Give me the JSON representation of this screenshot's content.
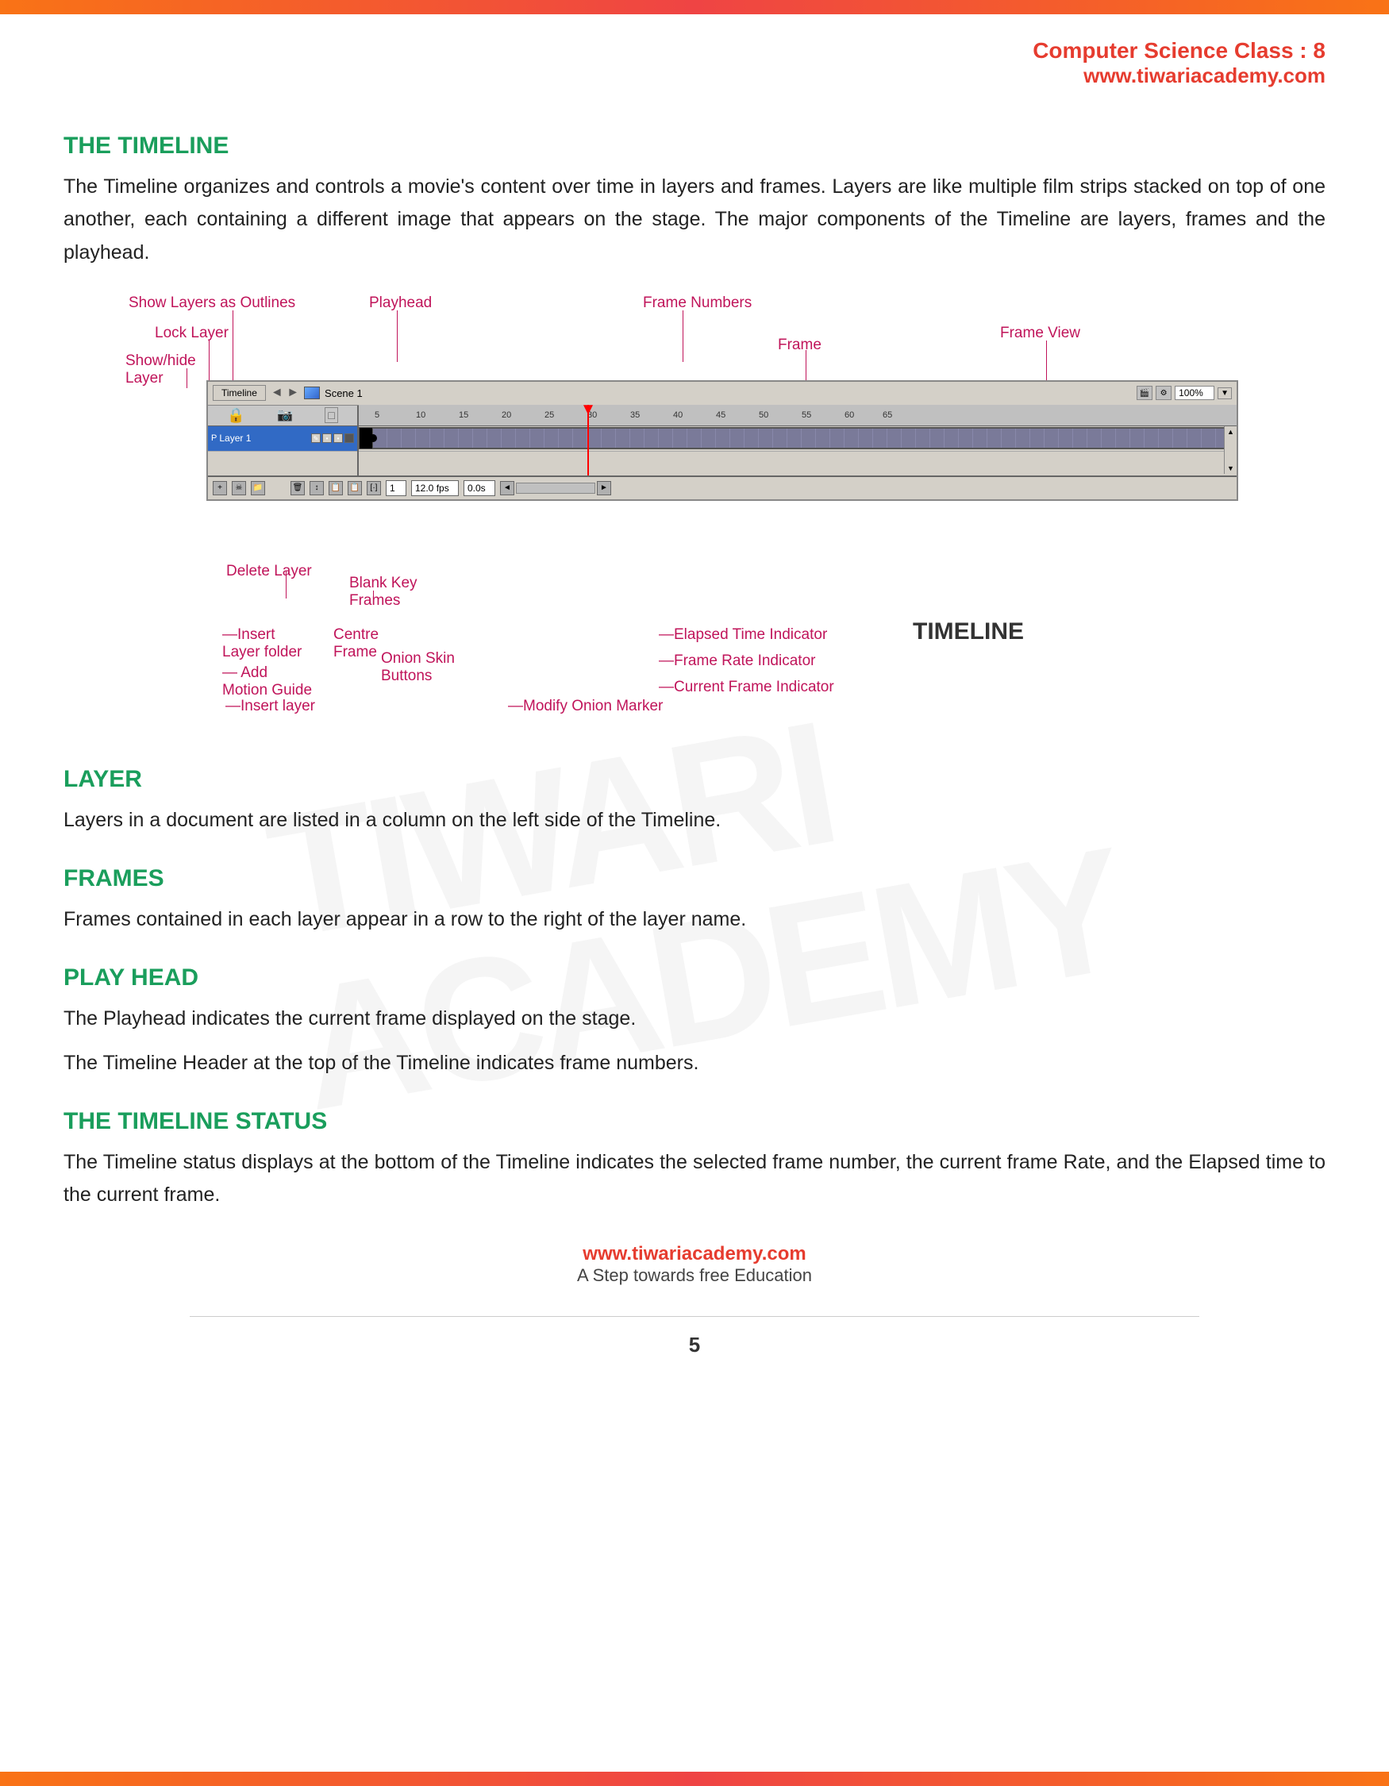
{
  "header": {
    "title": "Computer Science Class : 8",
    "url": "www.tiwariacademy.com"
  },
  "sections": {
    "timeline_heading": "THE TIMELINE",
    "timeline_body1": "The  Timeline  organizes  and  controls  a  movie's  content  over  time  in  layers  and  frames. Layers are like multiple film strips stacked on top of one another, each containing a different image that appears on the stage. The major components of the Timeline are layers, frames and the playhead.",
    "layer_heading": "LAYER",
    "layer_body": "Layers in a document are listed in a column on the left side of the Timeline.",
    "frames_heading": "FRAMES",
    "frames_body": "Frames contained in each layer appear in a row to the right of the layer name.",
    "playhead_heading": "PLAY HEAD",
    "playhead_body1": "The Playhead indicates the current frame displayed on the stage.",
    "playhead_body2": "The Timeline Header at the top of the Timeline indicates frame numbers.",
    "status_heading": "THE TIMELINE STATUS",
    "status_body": "The  Timeline  status  displays  at  the  bottom  of  the  Timeline  indicates  the  selected  frame number, the current frame Rate, and the Elapsed time to the current frame.",
    "footer_url": "www.tiwariacademy.com",
    "footer_tagline": "A Step towards free Education",
    "page_number": "5"
  },
  "diagram": {
    "labels": {
      "show_layers": "Show Layers as Outlines",
      "lock_layer": "Lock Layer",
      "show_hide": "Show/hide\nLayer",
      "playhead": "Playhead",
      "frame_numbers": "Frame Numbers",
      "frame_view": "Frame View",
      "frame": "Frame",
      "delete_layer": "Delete Layer",
      "blank_key_frames": "Blank Key\nFrames",
      "insert_layer_folder": "Insert\nLayer folder",
      "add_motion_guide": "— Add\nMotion Guide",
      "insert_layer": "—Insert layer",
      "centre_frame": "Centre\nFrame",
      "onion_skin": "Onion Skin\nButtons",
      "modify_onion": "—Modify Onion Marker",
      "current_frame": "—Current Frame Indicator",
      "frame_rate": "—Frame Rate Indicator",
      "elapsed_time": "—Elapsed Time Indicator",
      "timeline_label": "TIMELINE"
    },
    "flash_ui": {
      "toolbar_btn": "Timeline",
      "scene": "Scene 1",
      "percent": "100%",
      "layer_name": "Layer 1",
      "fps": "12.0 fps",
      "time": "0.0s",
      "frame_num": "1",
      "ruler_numbers": [
        "5",
        "10",
        "15",
        "20",
        "25",
        "30",
        "35",
        "40",
        "45",
        "50",
        "55",
        "60",
        "65"
      ]
    }
  }
}
